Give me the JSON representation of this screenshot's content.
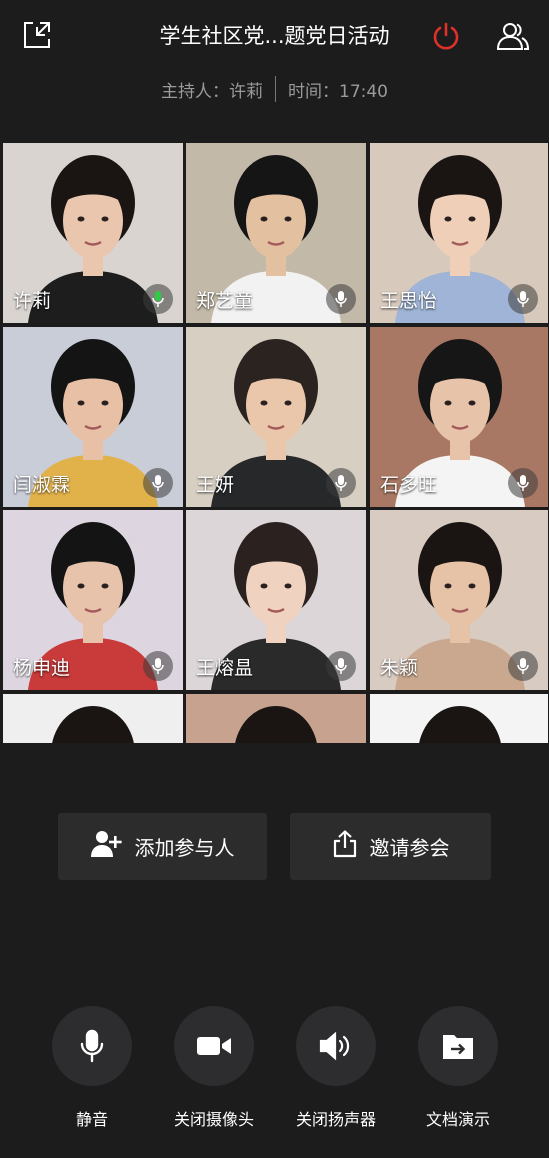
{
  "header": {
    "title": "学生社区党...题党日活动",
    "host_label": "主持人：许莉",
    "time_label": "时间：17:40"
  },
  "participants": [
    {
      "name": "许莉",
      "bg": "#d9d4cf",
      "skin": "#e9c6ad",
      "hair": "#1a1512",
      "shirt": "#1d1d1d"
    },
    {
      "name": "郑艺童",
      "bg": "#c2b9a8",
      "skin": "#e3c0a0",
      "hair": "#151515",
      "shirt": "#f2f2f2"
    },
    {
      "name": "王思怡",
      "bg": "#d7c9bb",
      "skin": "#efcfb8",
      "hair": "#1a1512",
      "shirt": "#9fb4d6"
    },
    {
      "name": "闫淑霖",
      "bg": "#c9cdd8",
      "skin": "#e8c0a6",
      "hair": "#141414",
      "shirt": "#e2b24a"
    },
    {
      "name": "王妍",
      "bg": "#d8cfc3",
      "skin": "#eac7ab",
      "hair": "#2a2320",
      "shirt": "#26282a"
    },
    {
      "name": "石多旺",
      "bg": "#a97864",
      "skin": "#e7c4a9",
      "hair": "#161616",
      "shirt": "#f4f4f4"
    },
    {
      "name": "杨申迪",
      "bg": "#ddd6e0",
      "skin": "#e8c3ac",
      "hair": "#141414",
      "shirt": "#c93a3a"
    },
    {
      "name": "王熔昷",
      "bg": "#dcd6d8",
      "skin": "#f0d2c0",
      "hair": "#2b2220",
      "shirt": "#2a2a2a"
    },
    {
      "name": "朱颖",
      "bg": "#d8cbc2",
      "skin": "#e6c2a6",
      "hair": "#1a1512",
      "shirt": "#c9a88f"
    },
    {
      "name": "",
      "bg": "#efefef",
      "skin": "#e4c4a8",
      "hair": "#1a1512",
      "shirt": "#222"
    },
    {
      "name": "",
      "bg": "#c7a28f",
      "skin": "#e4c4a8",
      "hair": "#1a1512",
      "shirt": "#222"
    },
    {
      "name": "",
      "bg": "#f4f4f4",
      "skin": "#e4c4a8",
      "hair": "#1a1512",
      "shirt": "#222"
    }
  ],
  "actions": {
    "add_participant": "添加参与人",
    "invite": "邀请参会"
  },
  "controls": {
    "mute": "静音",
    "camera_off": "关闭摄像头",
    "speaker_off": "关闭扬声器",
    "doc_present": "文档演示"
  },
  "colors": {
    "background": "#1c1c1d",
    "button_bg": "#2c2c2d",
    "power_red": "#e0302a",
    "mic_active_green": "#2ecc40"
  }
}
